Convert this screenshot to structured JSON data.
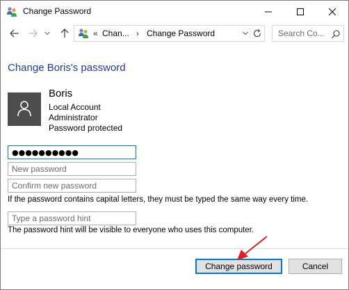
{
  "window": {
    "title": "Change Password",
    "controls": {
      "minimize": "minimize",
      "maximize": "maximize",
      "close": "close"
    }
  },
  "address_bar": {
    "prefix": "«",
    "crumbs": [
      "Chan...",
      "Change Password"
    ],
    "separator": "›"
  },
  "search": {
    "placeholder": "Search Co..."
  },
  "main": {
    "heading": "Change Boris's password",
    "user": {
      "name": "Boris",
      "lines": [
        "Local Account",
        "Administrator",
        "Password protected"
      ]
    },
    "current_password_value": "●●●●●●●●●●",
    "new_password_placeholder": "New password",
    "confirm_password_placeholder": "Confirm new password",
    "capitals_note": "If the password contains capital letters, they must be typed the same way every time.",
    "hint_placeholder": "Type a password hint",
    "hint_note": "The password hint will be visible to everyone who uses this computer."
  },
  "buttons": {
    "change": "Change password",
    "cancel": "Cancel"
  },
  "colors": {
    "heading": "#1e3d8f",
    "accent": "#0078d7",
    "avatar_bg": "#4d4d4d",
    "annotation_arrow": "#e02020"
  },
  "icons": [
    "users-icon",
    "back-arrow-icon",
    "forward-arrow-icon",
    "chevron-down-icon",
    "up-arrow-icon",
    "refresh-icon",
    "search-icon",
    "user-silhouette-icon"
  ]
}
